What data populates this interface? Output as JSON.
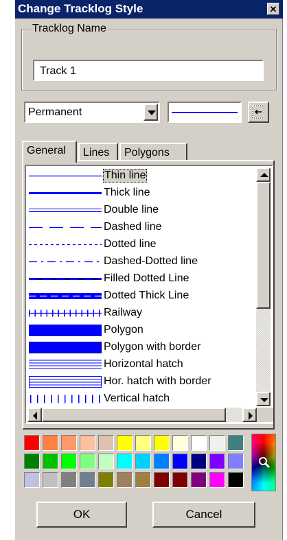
{
  "window": {
    "title": "Change Tracklog Style",
    "close_glyph": "✕"
  },
  "tracklog": {
    "group_label": "Tracklog Name",
    "name_value": "Track 1"
  },
  "type_select": {
    "value": "Permanent"
  },
  "preview": {
    "line_color": "#0000ff"
  },
  "tabs": [
    {
      "label": "General",
      "active": true
    },
    {
      "label": "Lines",
      "active": false
    },
    {
      "label": "Polygons",
      "active": false
    }
  ],
  "styles": [
    {
      "label": "Thin line",
      "selected": true
    },
    {
      "label": "Thick line"
    },
    {
      "label": "Double line"
    },
    {
      "label": "Dashed line"
    },
    {
      "label": "Dotted line"
    },
    {
      "label": "Dashed-Dotted line"
    },
    {
      "label": "Filled Dotted Line"
    },
    {
      "label": "Dotted Thick Line"
    },
    {
      "label": "Railway"
    },
    {
      "label": "Polygon"
    },
    {
      "label": "Polygon with border"
    },
    {
      "label": "Horizontal hatch"
    },
    {
      "label": "Hor. hatch with border"
    },
    {
      "label": "Vertical hatch"
    }
  ],
  "palette": {
    "rows": [
      [
        "#ff0000",
        "#ff8040",
        "#ff9966",
        "#ffc0a0",
        "#e0c0b0",
        "#ffff00",
        "#ffff80",
        "#ffff00",
        "#ffffe0",
        "#ffffff",
        "#f0f0f0",
        "#408080"
      ],
      [
        "#008000",
        "#00c000",
        "#00ff00",
        "#80ff80",
        "#c0ffc0",
        "#00ffff",
        "#00d0ff",
        "#0080ff",
        "#0000ff",
        "#000080",
        "#8000ff",
        "#8080ff"
      ],
      [
        "#c0c0e0",
        "#c0c0c0",
        "#808080",
        "#708090",
        "#808000",
        "#a08060",
        "#a08040",
        "#800000",
        "#800000",
        "#800080",
        "#ff00ff",
        "#000000"
      ]
    ],
    "picker_icon": "magnifier-icon"
  },
  "buttons": {
    "ok": "OK",
    "cancel": "Cancel"
  },
  "colors": {
    "titlebar": "#0a246a",
    "face": "#d4d0c8",
    "line_blue": "#0000ff"
  }
}
